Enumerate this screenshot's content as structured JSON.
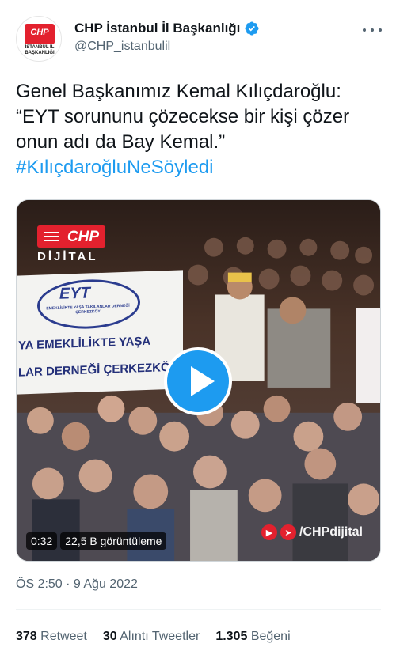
{
  "author": {
    "display_name": "CHP İstanbul İl Başkanlığı",
    "handle": "@CHP_istanbulil",
    "avatar_logo": "CHP",
    "avatar_subtext": "İSTANBUL İL BAŞKANLIĞI",
    "verified_icon": "verified-badge-icon",
    "badge_color": "#1d9bf0"
  },
  "tweet": {
    "text": "Genel Başkanımız Kemal Kılıçdaroğlu: “EYT sorununu çözecekse bir kişi çözer onun adı da Bay Kemal.” ",
    "hashtag": "#KılıçdaroğluNeSöyledi",
    "timestamp": "ÖS 2:50 · 9 Ağu 2022"
  },
  "media": {
    "logo_text": "CHP",
    "logo_subtext": "DİJİTAL",
    "banner_logo": "EYT",
    "banner_small": "EMEKLİLİKTE YAŞA TAKILANLAR DERNEĞİ ÇERKEZKÖY",
    "banner_line1": "YA EMEKLİLİKTE YAŞA",
    "banner_line2": "LAR DERNEĞİ ÇERKEZKÖY",
    "duration": "0:32",
    "views": "22,5 B görüntüleme",
    "watermark": "/CHPdijital",
    "play_icon": "play-icon",
    "accent": "#e3212e"
  },
  "stats": {
    "retweets_count": "378",
    "retweets_label": "Retweet",
    "quotes_count": "30",
    "quotes_label": "Alıntı Tweetler",
    "likes_count": "1.305",
    "likes_label": "Beğeni"
  }
}
